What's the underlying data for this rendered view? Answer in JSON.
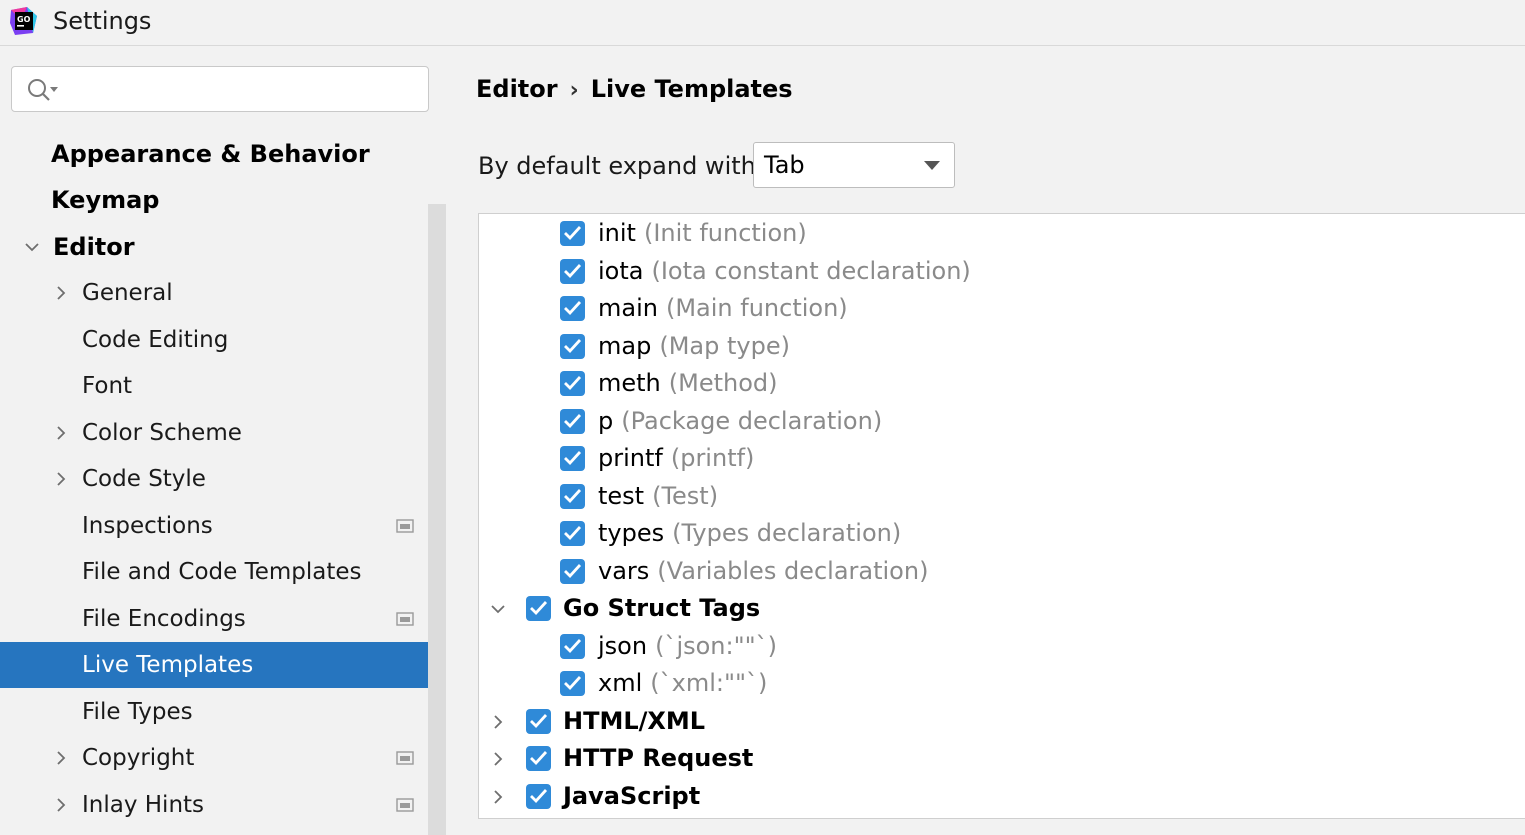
{
  "window": {
    "title": "Settings",
    "app_icon": "goland-icon"
  },
  "sidebar": {
    "search": {
      "value": "",
      "placeholder": ""
    },
    "items": [
      {
        "label": "Appearance & Behavior",
        "level": 0,
        "bold": true,
        "chevron": "none",
        "page_icon": false,
        "selected": false
      },
      {
        "label": "Keymap",
        "level": 0,
        "bold": true,
        "chevron": "none",
        "page_icon": false,
        "selected": false
      },
      {
        "label": "Editor",
        "level": 0,
        "bold": true,
        "chevron": "down",
        "page_icon": false,
        "selected": false
      },
      {
        "label": "General",
        "level": 1,
        "bold": false,
        "chevron": "right",
        "page_icon": false,
        "selected": false
      },
      {
        "label": "Code Editing",
        "level": 1,
        "bold": false,
        "chevron": "none",
        "page_icon": false,
        "selected": false
      },
      {
        "label": "Font",
        "level": 1,
        "bold": false,
        "chevron": "none",
        "page_icon": false,
        "selected": false
      },
      {
        "label": "Color Scheme",
        "level": 1,
        "bold": false,
        "chevron": "right",
        "page_icon": false,
        "selected": false
      },
      {
        "label": "Code Style",
        "level": 1,
        "bold": false,
        "chevron": "right",
        "page_icon": false,
        "selected": false
      },
      {
        "label": "Inspections",
        "level": 1,
        "bold": false,
        "chevron": "none",
        "page_icon": true,
        "selected": false
      },
      {
        "label": "File and Code Templates",
        "level": 1,
        "bold": false,
        "chevron": "none",
        "page_icon": false,
        "selected": false
      },
      {
        "label": "File Encodings",
        "level": 1,
        "bold": false,
        "chevron": "none",
        "page_icon": true,
        "selected": false
      },
      {
        "label": "Live Templates",
        "level": 1,
        "bold": false,
        "chevron": "none",
        "page_icon": false,
        "selected": true
      },
      {
        "label": "File Types",
        "level": 1,
        "bold": false,
        "chevron": "none",
        "page_icon": false,
        "selected": false
      },
      {
        "label": "Copyright",
        "level": 1,
        "bold": false,
        "chevron": "right",
        "page_icon": true,
        "selected": false
      },
      {
        "label": "Inlay Hints",
        "level": 1,
        "bold": false,
        "chevron": "right",
        "page_icon": true,
        "selected": false
      }
    ]
  },
  "main": {
    "breadcrumb": [
      "Editor",
      "Live Templates"
    ],
    "breadcrumb_separator": "›",
    "expand_label": "By default expand with",
    "expand_value": "Tab",
    "templates": [
      {
        "name": "init",
        "desc": "(Init function)",
        "checked": true,
        "group": false
      },
      {
        "name": "iota",
        "desc": "(Iota constant declaration)",
        "checked": true,
        "group": false
      },
      {
        "name": "main",
        "desc": "(Main function)",
        "checked": true,
        "group": false
      },
      {
        "name": "map",
        "desc": "(Map type)",
        "checked": true,
        "group": false
      },
      {
        "name": "meth",
        "desc": "(Method)",
        "checked": true,
        "group": false
      },
      {
        "name": "p",
        "desc": "(Package declaration)",
        "checked": true,
        "group": false
      },
      {
        "name": "printf",
        "desc": "(printf)",
        "checked": true,
        "group": false
      },
      {
        "name": "test",
        "desc": "(Test)",
        "checked": true,
        "group": false
      },
      {
        "name": "types",
        "desc": "(Types declaration)",
        "checked": true,
        "group": false
      },
      {
        "name": "vars",
        "desc": "(Variables declaration)",
        "checked": true,
        "group": false
      },
      {
        "name": "Go Struct Tags",
        "desc": "",
        "checked": true,
        "group": true,
        "expanded": true
      },
      {
        "name": "json",
        "desc": "(`json:\"\"`)",
        "checked": true,
        "group": false
      },
      {
        "name": "xml",
        "desc": "(`xml:\"\"`)",
        "checked": true,
        "group": false
      },
      {
        "name": "HTML/XML",
        "desc": "",
        "checked": true,
        "group": true,
        "expanded": false
      },
      {
        "name": "HTTP Request",
        "desc": "",
        "checked": true,
        "group": true,
        "expanded": false
      },
      {
        "name": "JavaScript",
        "desc": "",
        "checked": true,
        "group": true,
        "expanded": false
      }
    ]
  },
  "colors": {
    "selection": "#2675bf",
    "checkbox": "#2f8ad8",
    "description": "#8a8a8a"
  }
}
